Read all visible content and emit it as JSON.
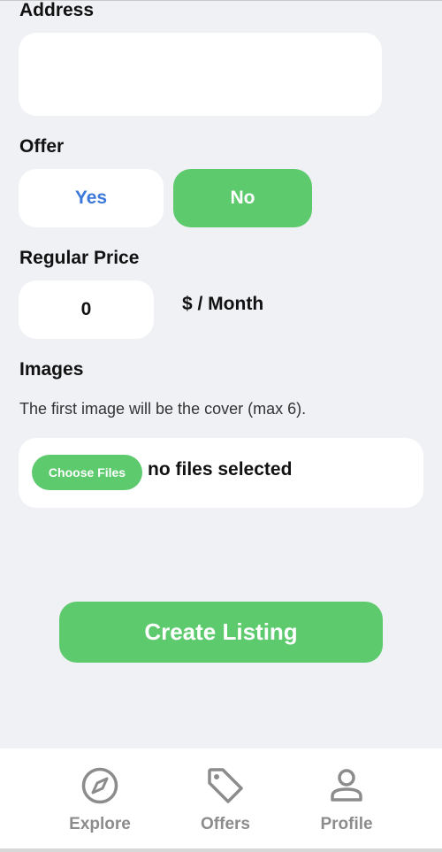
{
  "form": {
    "address_label": "Address",
    "address_value": "",
    "offer_label": "Offer",
    "offer_yes": "Yes",
    "offer_no": "No",
    "offer_selected": "No",
    "regular_price_label": "Regular Price",
    "regular_price_value": "0",
    "price_unit": "$ / Month",
    "images_label": "Images",
    "images_hint": "The first image will be the cover (max 6).",
    "choose_files_label": "Choose Files",
    "file_status": "no files selected",
    "submit_label": "Create Listing"
  },
  "nav": {
    "items": [
      {
        "label": "Explore",
        "icon": "compass-icon"
      },
      {
        "label": "Offers",
        "icon": "tag-icon"
      },
      {
        "label": "Profile",
        "icon": "person-icon"
      }
    ]
  },
  "colors": {
    "accent": "#5dca6e",
    "link_blue": "#3b78d9",
    "background": "#f0f1f5",
    "nav_inactive": "#8c8c8c"
  }
}
